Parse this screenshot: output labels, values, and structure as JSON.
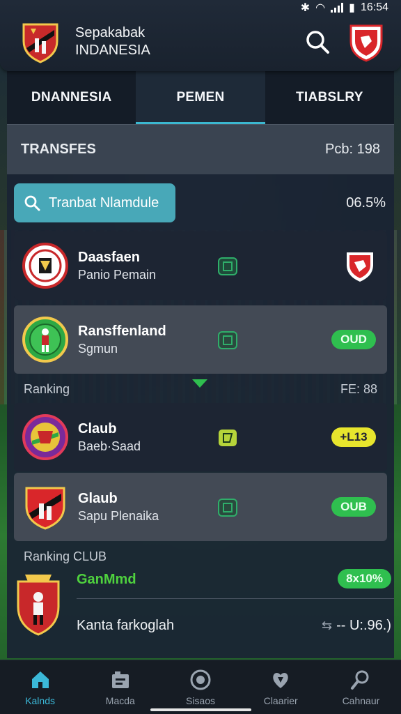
{
  "status_bar": {
    "time": "16:54"
  },
  "header": {
    "title_line1": "Sepakabak",
    "title_line2": "INDANESIA"
  },
  "tabs": [
    {
      "label": "DNANNESIA",
      "active": false
    },
    {
      "label": "PEMEN",
      "active": true
    },
    {
      "label": "TIABSLRY",
      "active": false
    }
  ],
  "section": {
    "title": "TRANSFES",
    "right": "Pcb: 198"
  },
  "search": {
    "button_label": "Tranbat Nlamdule",
    "percentage": "06.5%"
  },
  "transfers": [
    {
      "title": "Daasfaen",
      "subtitle": "Panio Pemain",
      "right_type": "shield"
    },
    {
      "title": "Ransffenland",
      "subtitle": "Sgmun",
      "right_type": "pill",
      "badge": "OUD"
    }
  ],
  "ranking_header": {
    "label": "Ranking",
    "right": "FE: 88"
  },
  "clubs": [
    {
      "title": "Claub",
      "subtitle": "Baeb·Saad",
      "right_type": "pill",
      "badge": "+L13",
      "badge_color": "#e7e52d"
    },
    {
      "title": "Glaub",
      "subtitle": "Sapu Plenaika",
      "right_type": "pill",
      "badge": "OUB",
      "badge_color": "#2fbf4f"
    }
  ],
  "ranking_club": {
    "label": "Ranking CLUB",
    "title": "GanMmd",
    "badge": "8x10%",
    "subtitle": "Kanta farkoglah",
    "right_value": "-- U:.96.)"
  },
  "nav": [
    {
      "label": "Kalnds",
      "icon": "home-icon",
      "active": true
    },
    {
      "label": "Macda",
      "icon": "news-icon",
      "active": false
    },
    {
      "label": "Sisaos",
      "icon": "target-icon",
      "active": false
    },
    {
      "label": "Claarier",
      "icon": "heart-shield-icon",
      "active": false
    },
    {
      "label": "Cahnaur",
      "icon": "whistle-icon",
      "active": false
    }
  ],
  "colors": {
    "accent": "#3bb8d0",
    "green": "#2fbf4f",
    "yellow": "#e7e52d"
  }
}
